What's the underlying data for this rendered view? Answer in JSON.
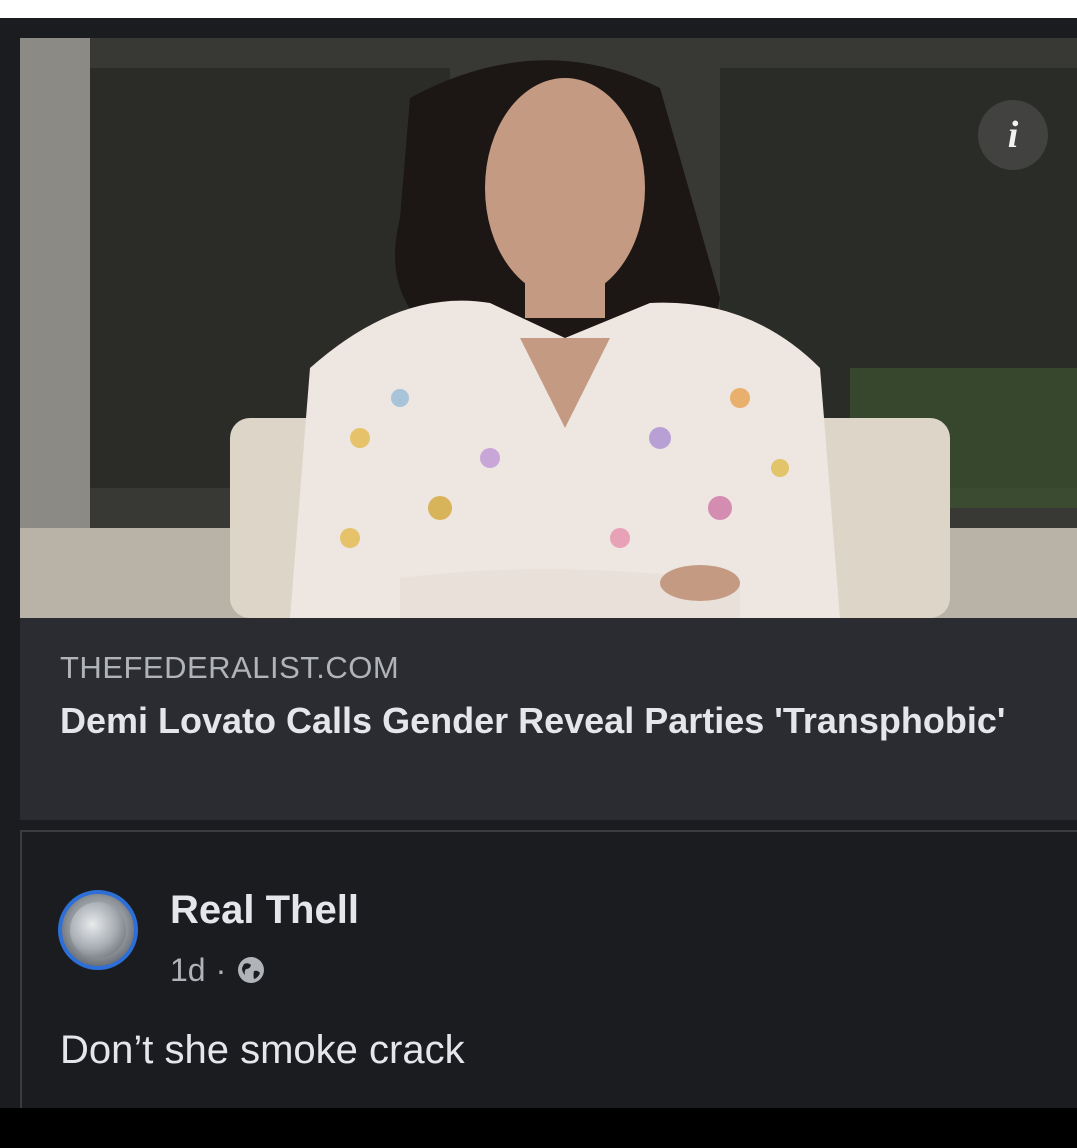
{
  "link_preview": {
    "domain": "THEFEDERALIST.COM",
    "headline": "Demi Lovato Calls Gender Reveal Parties 'Transphobic'",
    "info_icon": "info-icon",
    "info_glyph": "i"
  },
  "comment": {
    "author": "Real Thell",
    "timestamp": "1d",
    "separator": "·",
    "privacy_icon": "globe-icon",
    "text": "Don’t she smoke crack"
  },
  "colors": {
    "background": "#1b1c20",
    "card": "#2b2c31",
    "primary_text": "#e4e6eb",
    "secondary_text": "#b0b3b8",
    "avatar_ring": "#2d6fd6"
  }
}
